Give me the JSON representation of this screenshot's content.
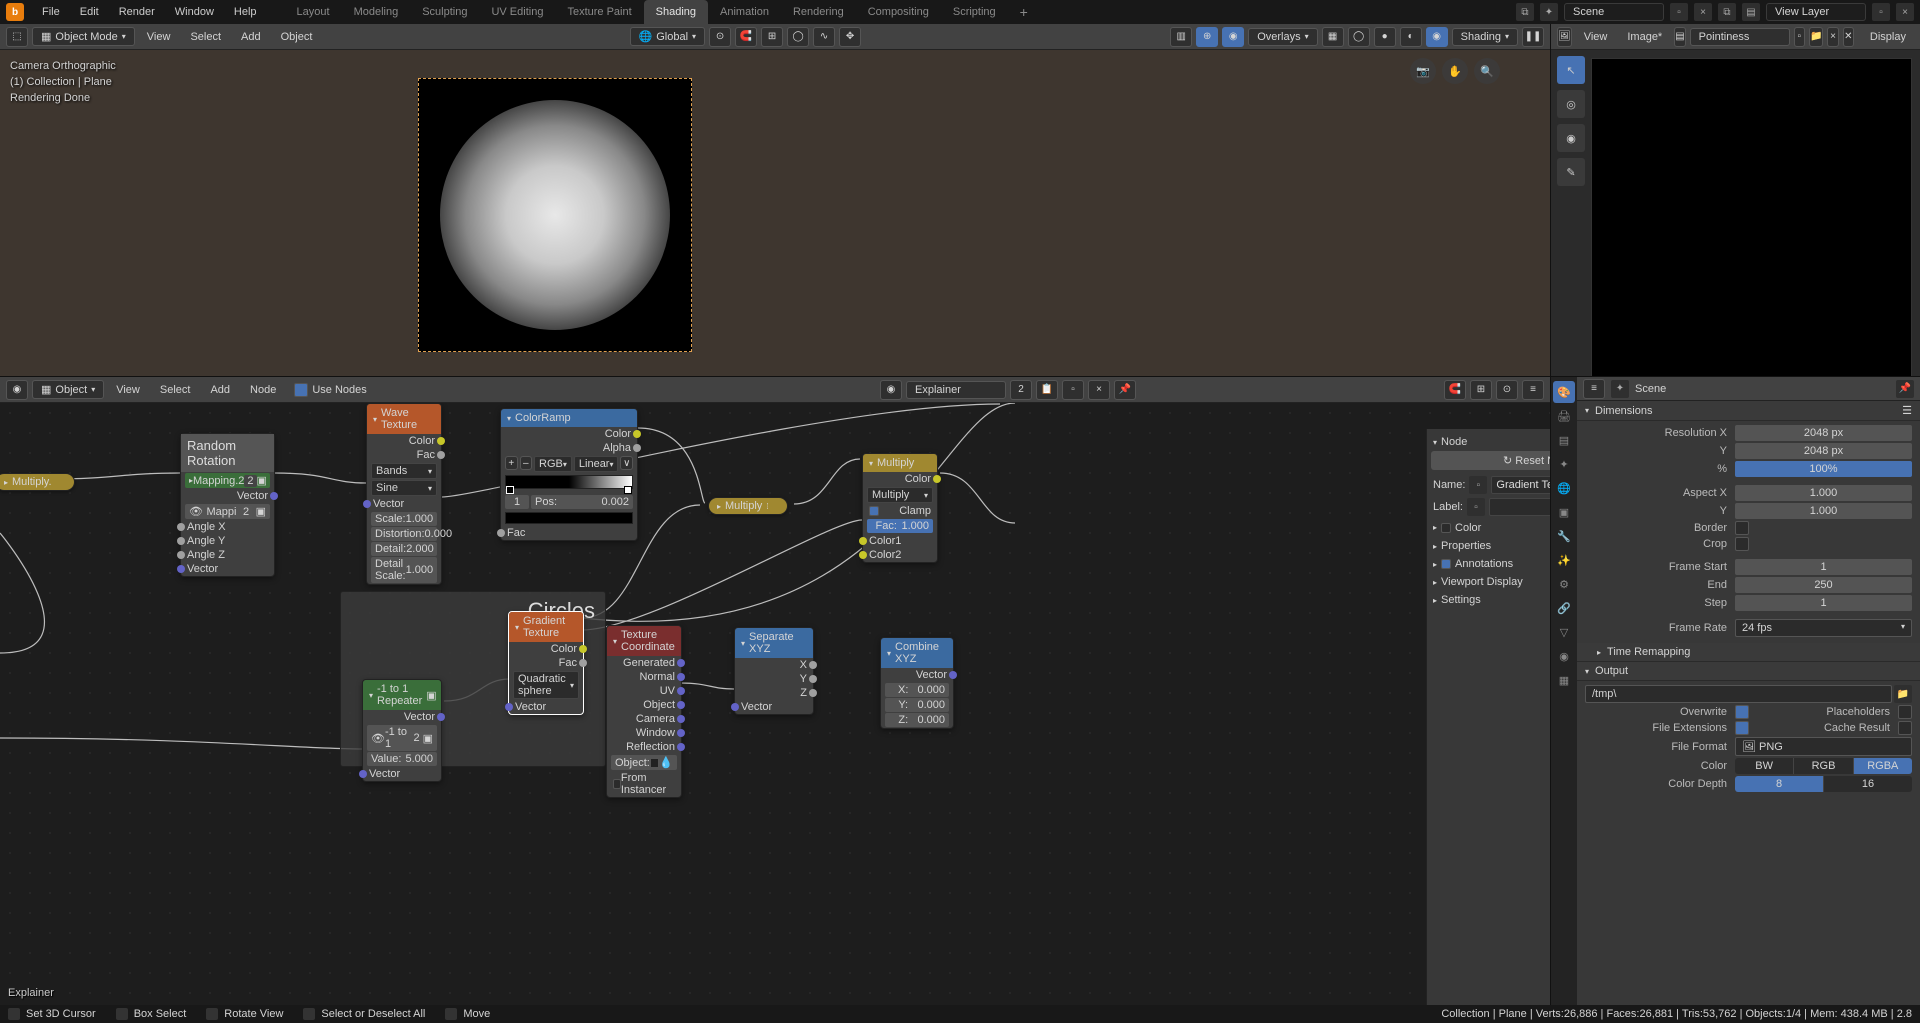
{
  "app": {
    "menus": [
      "File",
      "Edit",
      "Render",
      "Window",
      "Help"
    ]
  },
  "workspaces": {
    "tabs": [
      "Layout",
      "Modeling",
      "Sculpting",
      "UV Editing",
      "Texture Paint",
      "Shading",
      "Animation",
      "Rendering",
      "Compositing",
      "Scripting"
    ],
    "active": "Shading",
    "plus": "+"
  },
  "scene_field": {
    "label": "Scene",
    "viewlayer": "View Layer"
  },
  "vp3d": {
    "mode": "Object Mode",
    "menus": [
      "View",
      "Select",
      "Add",
      "Object"
    ],
    "orient": "Global",
    "overlays": "Overlays",
    "shading": "Shading",
    "overlay_lines": [
      "Camera Orthographic",
      "(1) Collection | Plane",
      "Rendering Done"
    ]
  },
  "image_editor": {
    "menus": [
      "View",
      "Image*"
    ],
    "slot_label": "Pointiness",
    "display": "Display"
  },
  "node_editor": {
    "obj": "Object",
    "menus": [
      "View",
      "Select",
      "Add",
      "Node"
    ],
    "use_nodes": "Use Nodes",
    "material": "Explainer",
    "mat_users": "2",
    "frame_title": "Circles",
    "breadcrumb": "Explainer",
    "sidebar": {
      "title": "Node",
      "reset": "Reset Node",
      "name_lbl": "Name:",
      "name_val": "Gradient Tex..",
      "label_lbl": "Label:",
      "sections": [
        "Color",
        "Properties",
        "Annotations",
        "Viewport Display",
        "Settings"
      ]
    },
    "nodes": {
      "random_rotation": {
        "title": "Random Rotation",
        "mapping": "Mapping.2",
        "mcount": "2",
        "vector": "Vector",
        "ang": [
          "Angle X",
          "Angle Y",
          "Angle Z"
        ],
        "mappi": "Mappi"
      },
      "wave": {
        "title": "Wave Texture",
        "outs": [
          "Color",
          "Fac"
        ],
        "type": "Bands",
        "profile": "Sine",
        "vector": "Vector",
        "fields": [
          [
            "Scale:",
            "1.000"
          ],
          [
            "Distortion:",
            "0.000"
          ],
          [
            "Detail:",
            "2.000"
          ],
          [
            "Detail Scale:",
            "1.000"
          ]
        ]
      },
      "colorramp": {
        "title": "ColorRamp",
        "outs": [
          "Color",
          "Alpha"
        ],
        "mode": "RGB",
        "interp": "Linear",
        "stop": "1",
        "pos_lbl": "Pos:",
        "pos_val": "0.002",
        "fac": "Fac",
        "plus": "+",
        "minus": "–",
        "flip": "∨"
      },
      "multiply_top": "Multiply.",
      "multiply_yellow": "Multiply",
      "mix": {
        "title": "Multiply",
        "out": "Color",
        "blend": "Multiply",
        "clamp": "Clamp",
        "fac_lbl": "Fac:",
        "fac_val": "1.000",
        "c1": "Color1",
        "c2": "Color2"
      },
      "gradient": {
        "title": "Gradient Texture",
        "outs": [
          "Color",
          "Fac"
        ],
        "type": "Quadratic sphere",
        "vector": "Vector"
      },
      "repeater": {
        "title": "-1 to 1 Repeater",
        "vector": "Vector",
        "grp": "-1 to 1",
        "gc": "2",
        "val_lbl": "Value:",
        "val": "5.000"
      },
      "texcoord": {
        "title": "Texture Coordinate",
        "outs": [
          "Generated",
          "Normal",
          "UV",
          "Object",
          "Camera",
          "Window",
          "Reflection"
        ],
        "obj_lbl": "Object:",
        "inst": "From Instancer"
      },
      "sepxyz": {
        "title": "Separate XYZ",
        "outs": [
          "X",
          "Y",
          "Z"
        ],
        "in": "Vector"
      },
      "combxyz": {
        "title": "Combine XYZ",
        "out": "Vector",
        "fields": [
          [
            "X:",
            "0.000"
          ],
          [
            "Y:",
            "0.000"
          ],
          [
            "Z:",
            "0.000"
          ]
        ]
      }
    }
  },
  "properties": {
    "header": "Scene",
    "dimensions": {
      "title": "Dimensions",
      "res_x_lbl": "Resolution X",
      "res_x": "2048 px",
      "res_y_lbl": "Y",
      "res_y": "2048 px",
      "pct_lbl": "%",
      "pct": "100%",
      "asp_x_lbl": "Aspect X",
      "asp_x": "1.000",
      "asp_y_lbl": "Y",
      "asp_y": "1.000",
      "border": "Border",
      "crop": "Crop",
      "fs_lbl": "Frame Start",
      "fs": "1",
      "fe_lbl": "End",
      "fe": "250",
      "st_lbl": "Step",
      "st": "1",
      "fr_lbl": "Frame Rate",
      "fr": "24 fps",
      "remap": "Time Remapping"
    },
    "output": {
      "title": "Output",
      "path": "/tmp\\",
      "overwrite": "Overwrite",
      "placeholders": "Placeholders",
      "ext": "File Extensions",
      "cache": "Cache Result",
      "ff_lbl": "File Format",
      "ff": "PNG",
      "color_lbl": "Color",
      "modes": [
        "BW",
        "RGB",
        "RGBA"
      ],
      "depth_lbl": "Color Depth",
      "depths": [
        "8",
        "16"
      ]
    }
  },
  "status": {
    "left": [
      [
        "Set 3D Cursor"
      ],
      [
        "Box Select"
      ],
      [
        "Rotate View"
      ],
      [
        "Select or Deselect All"
      ],
      [
        "Move"
      ]
    ],
    "right": "Collection | Plane | Verts:26,886 | Faces:26,881 | Tris:53,762 | Objects:1/4 | Mem: 438.4 MB | 2.8"
  }
}
